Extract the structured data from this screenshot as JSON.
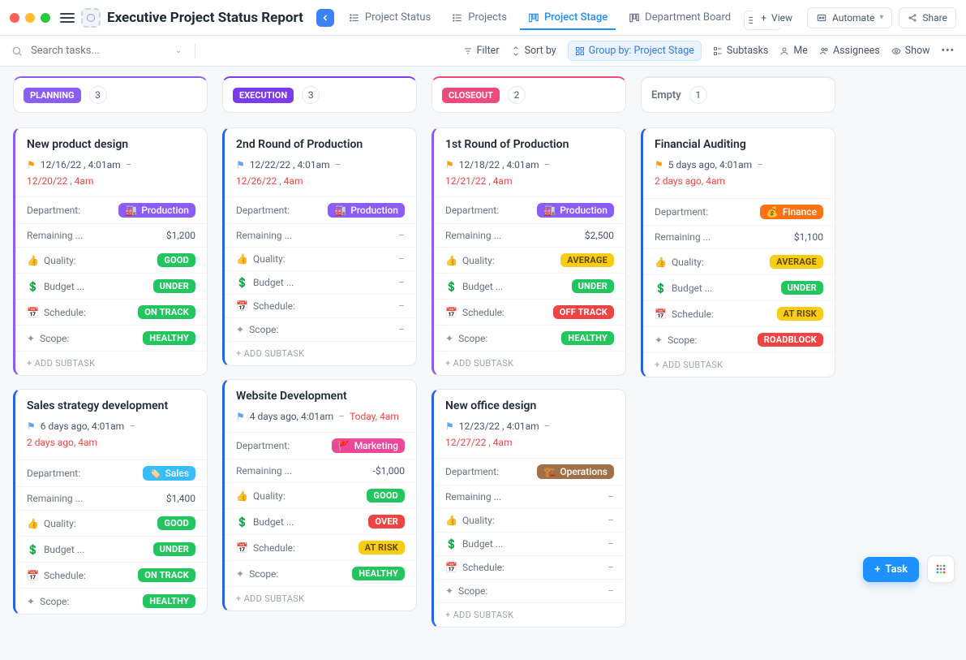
{
  "header": {
    "title": "Executive Project Status Report",
    "tabs": [
      {
        "label": "Project Status"
      },
      {
        "label": "Projects"
      },
      {
        "label": "Project Stage",
        "active": true
      },
      {
        "label": "Department Board"
      }
    ],
    "view_label": "View",
    "automate_label": "Automate",
    "share_label": "Share"
  },
  "toolbar": {
    "search_placeholder": "Search tasks...",
    "filter_label": "Filter",
    "sort_label": "Sort by",
    "group_label": "Group by: Project Stage",
    "subtasks_label": "Subtasks",
    "me_label": "Me",
    "assignees_label": "Assignees",
    "show_label": "Show"
  },
  "labels": {
    "department": "Department:",
    "remaining": "Remaining ...",
    "quality": "Quality:",
    "budget": "Budget ...",
    "schedule": "Schedule:",
    "scope": "Scope:",
    "add_subtask": "+ ADD SUBTASK"
  },
  "status_colors": {
    "GOOD": "#22c55e",
    "AVERAGE": "#facc15",
    "UNDER": "#22c55e",
    "OVER": "#ef4444",
    "ON TRACK": "#22c55e",
    "OFF TRACK": "#ef4444",
    "AT RISK": "#facc15",
    "HEALTHY": "#22c55e",
    "ROADBLOCK": "#ef4444"
  },
  "dept_colors": {
    "Production": "#8b5cf6",
    "Sales": "#38bdf8",
    "Marketing": "#ec4899",
    "Operations": "#a07148",
    "Finance": "#f97316"
  },
  "dept_emoji": {
    "Production": "🏭",
    "Sales": "🏷️",
    "Marketing": "🚩",
    "Operations": "🏗️",
    "Finance": "💰"
  },
  "flag_colors": {
    "yellow": "#f59e0b",
    "blue": "#60a5fa"
  },
  "columns": [
    {
      "stage": "PLANNING",
      "stage_color": "#8b5cf6",
      "count": "3",
      "border": "#8b5cf6",
      "cards": [
        {
          "title": "New product design",
          "flag": "yellow",
          "accent": "#8b5cf6",
          "start": "12/16/22 , 4:01am",
          "end": "12/20/22 , 4am",
          "end_late": true,
          "department": "Production",
          "remaining": "$1,200",
          "quality": "GOOD",
          "budget": "UNDER",
          "schedule": "ON TRACK",
          "scope": "HEALTHY"
        },
        {
          "title": "Sales strategy development",
          "flag": "blue",
          "accent": "#2563eb",
          "start": "6 days ago, 4:01am",
          "end": "2 days ago, 4am",
          "end_late": true,
          "stack_dates": true,
          "department": "Sales",
          "remaining": "$1,400",
          "quality": "GOOD",
          "budget": "UNDER",
          "schedule": "ON TRACK",
          "scope": "HEALTHY",
          "no_subtask": true
        }
      ]
    },
    {
      "stage": "EXECUTION",
      "stage_color": "#7c3aed",
      "count": "3",
      "border": "#7c3aed",
      "cards": [
        {
          "title": "2nd Round of Production",
          "flag": "blue",
          "accent": "#2563eb",
          "start": "12/22/22 , 4:01am",
          "end": "12/26/22 , 4am",
          "end_late": true,
          "department": "Production",
          "remaining": "–",
          "quality": "–",
          "budget": "–",
          "schedule": "–",
          "scope": "–"
        },
        {
          "title": "Website Development",
          "flag": "blue",
          "accent": "#2563eb",
          "start": "4 days ago, 4:01am",
          "end": "Today, 4am",
          "end_late": true,
          "department": "Marketing",
          "remaining": "-$1,000",
          "quality": "GOOD",
          "budget": "OVER",
          "schedule": "AT RISK",
          "scope": "HEALTHY"
        }
      ]
    },
    {
      "stage": "CLOSEOUT",
      "stage_color": "#ef4a7b",
      "count": "2",
      "border": "#ef4a7b",
      "cards": [
        {
          "title": "1st Round of Production",
          "flag": "yellow",
          "accent": "#8b5cf6",
          "start": "12/18/22 , 4:01am",
          "end": "12/21/22 , 4am",
          "end_late": true,
          "department": "Production",
          "remaining": "$2,500",
          "quality": "AVERAGE",
          "budget": "UNDER",
          "schedule": "OFF TRACK",
          "scope": "HEALTHY"
        },
        {
          "title": "New office design",
          "flag": "blue",
          "accent": "#2563eb",
          "start": "12/23/22 , 4:01am",
          "end": "12/27/22 , 4am",
          "end_late": true,
          "department": "Operations",
          "remaining": "–",
          "quality": "–",
          "budget": "–",
          "schedule": "–",
          "scope": "–"
        }
      ]
    },
    {
      "stage": "Empty",
      "is_empty": true,
      "count": "1",
      "border": "#e5e7eb",
      "cards": [
        {
          "title": "Financial Auditing",
          "flag": "yellow",
          "accent": "#2563eb",
          "start": "5 days ago, 4:01am",
          "end": "2 days ago, 4am",
          "end_late": true,
          "stack_dates": true,
          "department": "Finance",
          "remaining": "$1,100",
          "quality": "AVERAGE",
          "budget": "UNDER",
          "schedule": "AT RISK",
          "scope": "ROADBLOCK"
        }
      ]
    }
  ],
  "fab": {
    "task_label": "Task"
  }
}
